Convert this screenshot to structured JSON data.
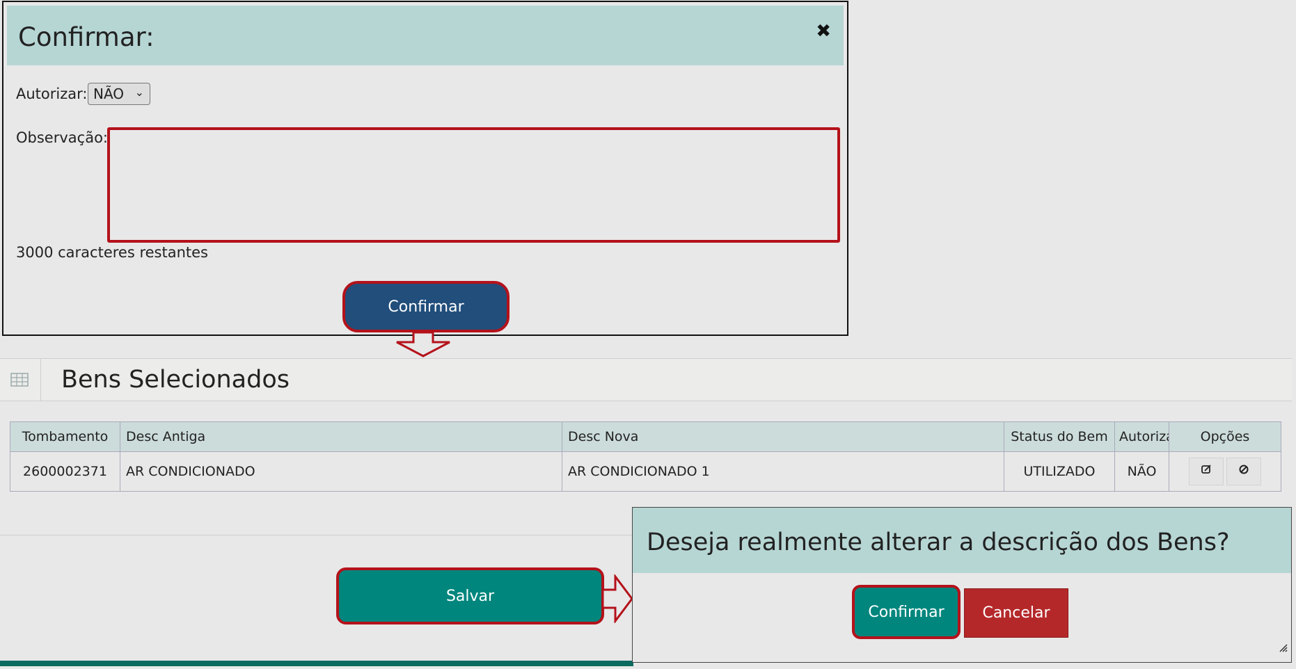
{
  "confirm_dialog": {
    "title": "Confirmar:",
    "close_glyph": "✖",
    "autorizar_label": "Autorizar:",
    "autorizar_value": "NÃO",
    "observacao_label": "Observação:",
    "observacao_value": "",
    "chars_remaining": "3000 caracteres restantes",
    "confirm_label": "Confirmar"
  },
  "panel": {
    "title": "Bens Selecionados",
    "columns": [
      "Tombamento",
      "Desc Antiga",
      "Desc Nova",
      "Status do Bem",
      "Autoriza",
      "Opções"
    ],
    "rows": [
      {
        "tombamento": "2600002371",
        "desc_antiga": "AR CONDICIONADO",
        "desc_nova": "AR CONDICIONADO 1",
        "status": "UTILIZADO",
        "autoriza": "NÃO"
      }
    ],
    "salvar_label": "Salvar"
  },
  "alert_dialog": {
    "title": "Deseja realmente alterar a descrição dos Bens?",
    "confirm_label": "Confirmar",
    "cancel_label": "Cancelar"
  },
  "colors": {
    "dialog_header": "#b6d6d4",
    "highlight_red": "#b4121b",
    "primary_blue": "#214e7b",
    "teal": "#00867d",
    "danger": "#b5282a"
  },
  "icons": [
    "close-icon",
    "chevron-down-icon",
    "table-grid-icon",
    "edit-icon",
    "block-icon",
    "arrow-down-icon",
    "arrow-right-icon",
    "resize-handle-icon"
  ]
}
